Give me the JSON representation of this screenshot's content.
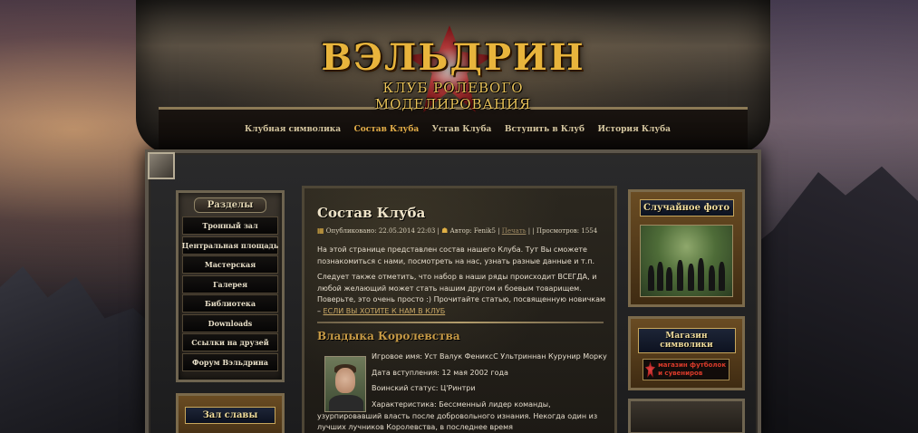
{
  "site": {
    "title": "ВЭЛЬДРИН",
    "subtitle": "КЛУБ РОЛЕВОГО МОДЕЛИРОВАНИЯ"
  },
  "topnav": [
    {
      "label": "Клубная символика",
      "active": false
    },
    {
      "label": "Состав Клуба",
      "active": true
    },
    {
      "label": "Устав Клуба",
      "active": false
    },
    {
      "label": "Вступить в Клуб",
      "active": false
    },
    {
      "label": "История Клуба",
      "active": false
    }
  ],
  "sidebar": {
    "heading": "Разделы",
    "items": [
      "Тронный зал",
      "Центральная площадь",
      "Мастерская",
      "Галерея",
      "Библиотека",
      "Downloads",
      "Ссылки на друзей",
      "Форум Вэльдрина"
    ],
    "hall_heading": "Зал славы"
  },
  "article": {
    "title": "Состав Клуба",
    "published": "Опубликовано: 22.05.2014 22:03",
    "author": "Автор: Fenik5",
    "print": "Печать",
    "views": "Просмотров: 1554",
    "intro": "На этой странице представлен состав нашего Клуба. Тут Вы сможете познакомиться с нами, посмотреть на нас, узнать разные данные и т.п.",
    "para2": "Следует также отметить, что набор в наши ряды происходит ВСЕГДА, и любой желающий может стать нашим другом и боевым товарищем. Поверьте, это очень просто :) Прочитайте статью, посвященную новичкам –",
    "join_link": "ЕСЛИ ВЫ ХОТИТЕ К НАМ В КЛУБ",
    "section_title": "Владыка Королевства",
    "member": {
      "game_name": "Игровое имя: Уст Валук ФениксС Ультриннан Курунир Морку",
      "joined": "Дата вступления: 12 мая 2002 года",
      "status": "Воинский статус: Ц'Ринтри",
      "bio": "Характеристика: Бессменный лидер команды, узурпировавший власть после добровольного изнания. Некогда один из лучших лучников Королевства, в последнее время"
    }
  },
  "right": {
    "random_photo_heading": "Случайное фото",
    "shop_heading": "Магазин символики",
    "shop_banner": "магазин футболок и сувениров"
  }
}
